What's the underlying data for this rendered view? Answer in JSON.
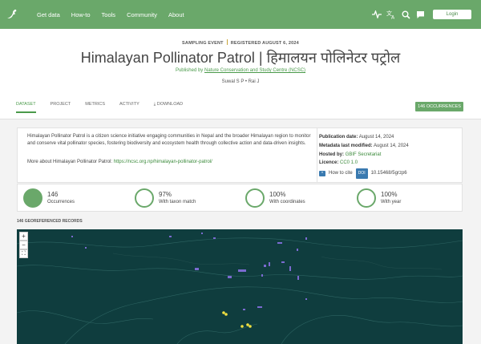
{
  "nav": {
    "links": [
      "Get data",
      "How-to",
      "Tools",
      "Community",
      "About"
    ],
    "login_label": "Login",
    "icons": [
      "activity-icon",
      "translate-icon",
      "search-icon",
      "chat-icon"
    ],
    "brand_color": "#6aa86a"
  },
  "header": {
    "event_type": "SAMPLING EVENT",
    "registered": "REGISTERED AUGUST 6, 2024",
    "title": "Himalayan Pollinator Patrol | हिमालयन पोलिनेटर पट्रोल",
    "published_by_prefix": "Published by",
    "publisher": "Nature Conservation and Study Centre (NCSC)",
    "authors": [
      "Suwal S P",
      "Rai J"
    ]
  },
  "tabs": [
    {
      "label": "DATASET",
      "active": true
    },
    {
      "label": "PROJECT",
      "active": false
    },
    {
      "label": "METRICS",
      "active": false
    },
    {
      "label": "ACTIVITY",
      "active": false
    },
    {
      "label": "DOWNLOAD",
      "active": false
    }
  ],
  "occurrences_badge": {
    "count": "146",
    "label": "OCCURRENCES"
  },
  "description": {
    "text": "Himalayan Pollinator Patrol is a citizen science initiative engaging communities in Nepal and the broader Himalayan region to monitor and conserve vital pollinator species, fostering biodiversity and ecosystem health through collective action and data-driven insights.",
    "more_prefix": "More about Himalayan Pollinator Patrol:",
    "more_link": "https://ncsc.org.np/himalayan-pollinator-patrol/"
  },
  "meta": {
    "publication_label": "Publication date:",
    "publication_date": "August 14, 2024",
    "modified_label": "Metadata last modified:",
    "modified_date": "August 14, 2024",
    "hosted_label": "Hosted by:",
    "hosted_by": "GBIF Secretariat",
    "licence_label": "Licence:",
    "licence": "CC0 1.0",
    "cite_label": "How to cite",
    "doi_label": "DOI",
    "doi": "10.15468/5grzp6"
  },
  "stats": [
    {
      "value": "146",
      "label": "Occurrences",
      "fraction": 1.0
    },
    {
      "value": "97%",
      "label": "With taxon match",
      "fraction": 0.97
    },
    {
      "value": "100%",
      "label": "With coordinates",
      "fraction": 1.0
    },
    {
      "value": "100%",
      "label": "With year",
      "fraction": 1.0
    }
  ],
  "georef_heading": "146 GEOREFERENCED RECORDS",
  "map": {
    "controls": [
      "+",
      "−",
      "⛶"
    ],
    "background": "#0f3d3e",
    "point_color": "#f0e040",
    "water_color": "#7a6bd0"
  }
}
